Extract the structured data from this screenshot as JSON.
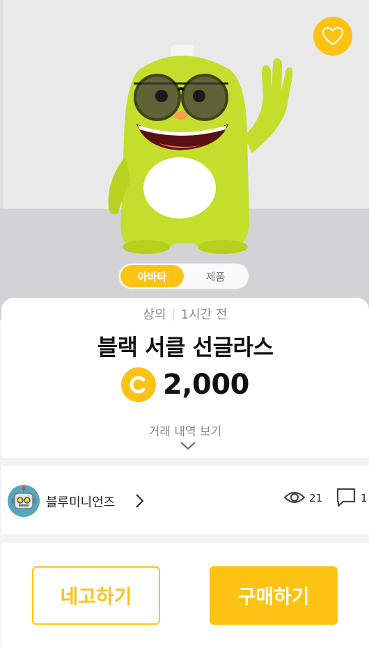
{
  "hero": {
    "favorite_icon": "heart-outline-icon",
    "view_toggle": {
      "options": [
        "아바타",
        "제품"
      ],
      "selected": "아바타"
    }
  },
  "item": {
    "category": "상의",
    "posted": "1시간 전",
    "title": "블랙 서클 선글라스",
    "price": "2,000",
    "coin_icon": "coin-c-icon",
    "history_label": "거래 내역 보기"
  },
  "seller": {
    "name": "블루미니언즈",
    "views": "21",
    "comments": "1"
  },
  "actions": {
    "offer_label": "네고하기",
    "buy_label": "구매하기"
  },
  "colors": {
    "accent": "#fcc314",
    "avatar_body": "#c5dd2c",
    "background": "#f2f2f2"
  }
}
